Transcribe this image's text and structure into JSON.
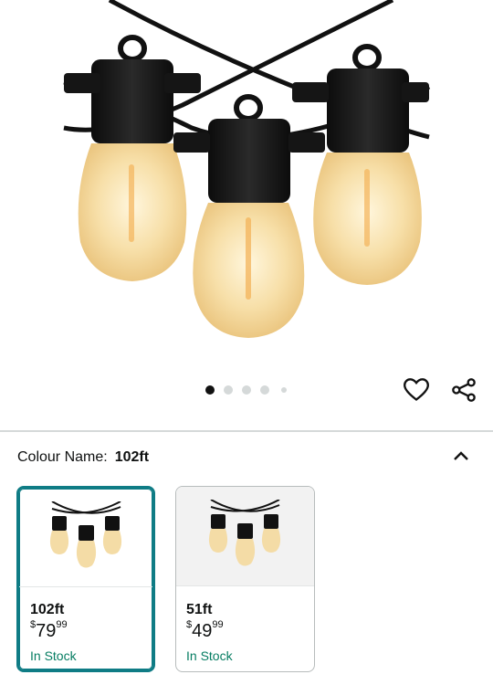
{
  "product": {
    "image_alt": "Outdoor LED string lights with three warm white bulbs",
    "carousel": {
      "count": 5,
      "active_index": 0
    }
  },
  "actions": {
    "wishlist_icon": "heart-icon",
    "share_icon": "share-icon"
  },
  "variation": {
    "label": "Colour Name:",
    "selected_value": "102ft",
    "collapse_icon": "chevron-up-icon"
  },
  "options": [
    {
      "name": "102ft",
      "currency": "$",
      "price_whole": "79",
      "price_fraction": "99",
      "availability": "In Stock",
      "selected": true
    },
    {
      "name": "51ft",
      "currency": "$",
      "price_whole": "49",
      "price_fraction": "99",
      "availability": "In Stock",
      "selected": false
    }
  ],
  "colors": {
    "accent": "#0f7c85",
    "in_stock": "#067d62",
    "divider": "#d5d9d9"
  }
}
